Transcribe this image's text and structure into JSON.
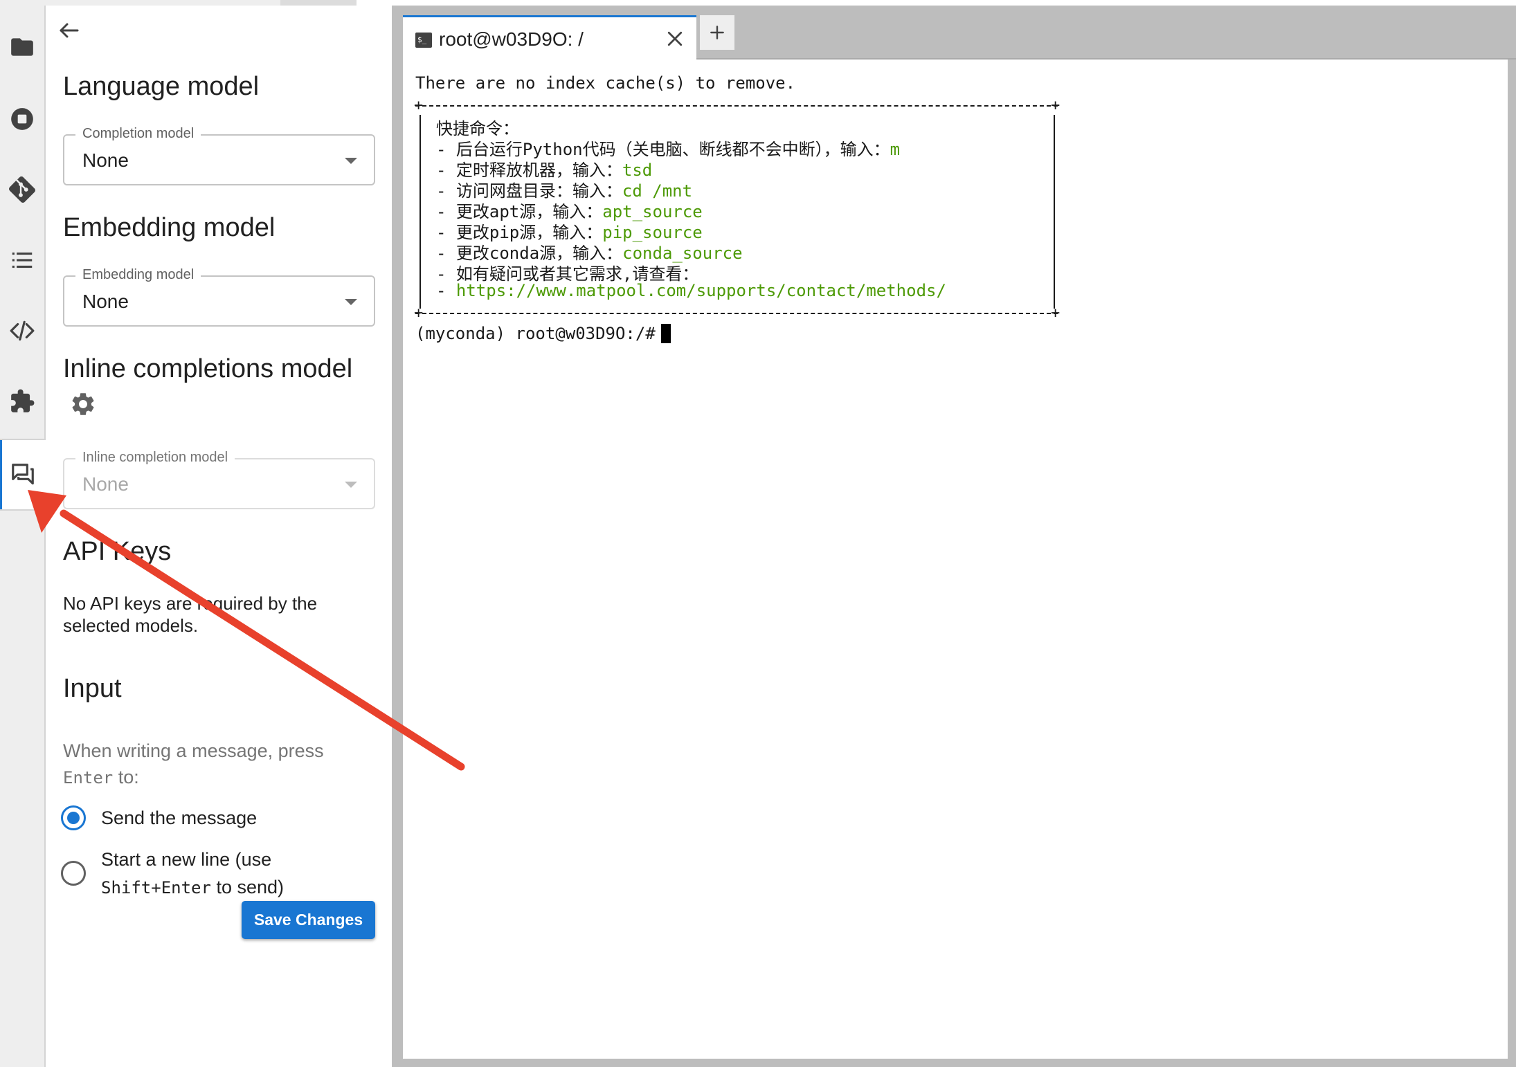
{
  "activity_bar": {
    "items": [
      {
        "name": "file-browser",
        "icon": "folder-icon"
      },
      {
        "name": "running-sessions",
        "icon": "stop-circle-icon"
      },
      {
        "name": "git",
        "icon": "git-icon"
      },
      {
        "name": "table-of-contents",
        "icon": "list-icon"
      },
      {
        "name": "property-inspector",
        "icon": "code-icon"
      },
      {
        "name": "extension-manager",
        "icon": "puzzle-icon"
      },
      {
        "name": "chat",
        "icon": "chat-icon",
        "active": true
      }
    ]
  },
  "settings": {
    "language_model": {
      "heading": "Language model",
      "field_label": "Completion model",
      "value": "None"
    },
    "embedding_model": {
      "heading": "Embedding model",
      "field_label": "Embedding model",
      "value": "None"
    },
    "inline_completions": {
      "heading": "Inline completions model",
      "field_label": "Inline completion model",
      "value": "None",
      "disabled": true
    },
    "api_keys": {
      "heading": "API Keys",
      "text": "No API keys are required by the selected models."
    },
    "input": {
      "heading": "Input",
      "hint_prefix": "When writing a message, press",
      "hint_key": "Enter",
      "hint_suffix": " to:",
      "option_send": "Send the message",
      "option_newline_prefix": "Start a new line (use",
      "option_newline_key": "Shift+Enter",
      "option_newline_suffix": " to send)",
      "selected": "send"
    },
    "save_label": "Save Changes"
  },
  "terminal": {
    "tab_title": "root@w03D9O: /",
    "new_tab_label": "+",
    "line_cache": "There are no index cache(s) to remove.",
    "box": {
      "title": "快捷命令：",
      "rows": [
        {
          "prefix": "- 后台运行Python代码（关电脑、断线都不会中断），输入：",
          "cmd": "m"
        },
        {
          "prefix": "- 定时释放机器，输入：",
          "cmd": "tsd"
        },
        {
          "prefix": "- 访问网盘目录：输入：",
          "cmd": "cd /mnt"
        },
        {
          "prefix": "- 更改apt源，输入：",
          "cmd": "apt_source"
        },
        {
          "prefix": "- 更改pip源，输入：",
          "cmd": "pip_source"
        },
        {
          "prefix": "- 更改conda源，输入：",
          "cmd": "conda_source"
        },
        {
          "prefix": "- 如有疑问或者其它需求,请查看：",
          "cmd": ""
        },
        {
          "prefix": "- ",
          "cmd": "https://www.matpool.com/supports/contact/methods/"
        }
      ]
    },
    "prompt": "(myconda) root@w03D9O:/#"
  },
  "colors": {
    "accent": "#1976d2",
    "terminal_green": "#4d9a06",
    "annotation_arrow": "#e8412c"
  }
}
